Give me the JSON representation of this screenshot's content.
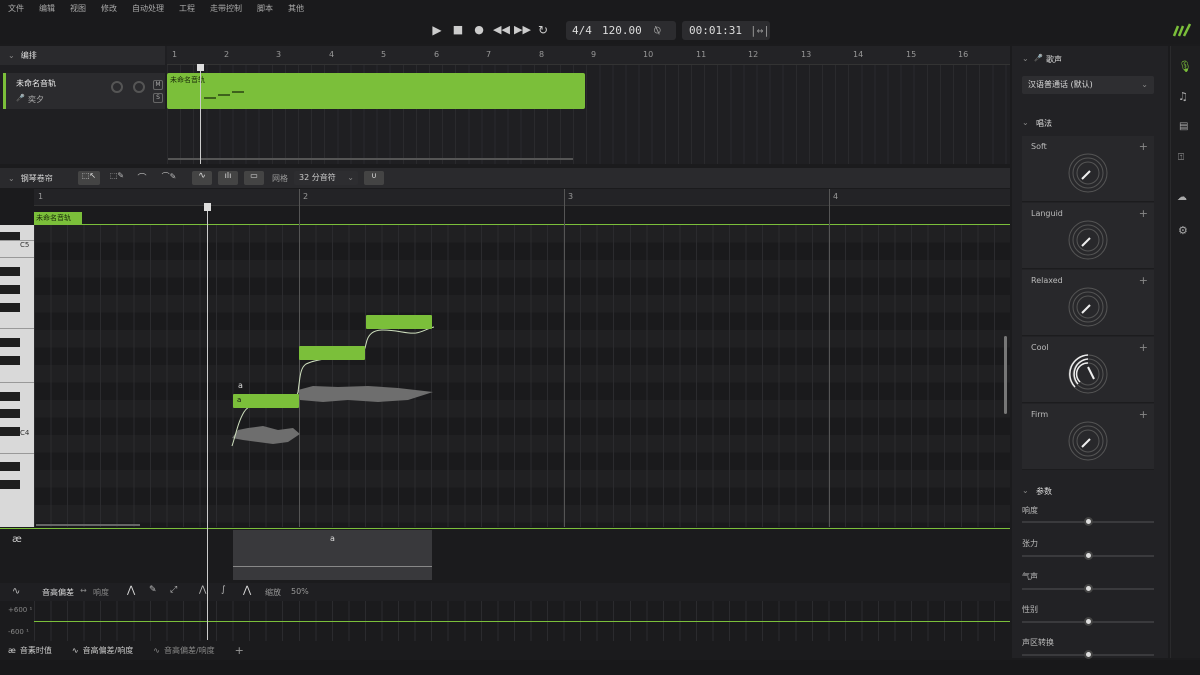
{
  "menu": [
    "文件",
    "编辑",
    "视图",
    "修改",
    "自动处理",
    "工程",
    "走带控制",
    "脚本",
    "其他"
  ],
  "transport": {
    "signature": "4/4",
    "tempo": "120.00",
    "time": "00:01:31"
  },
  "arrangement": {
    "title": "编排",
    "ruler": [
      "1",
      "2",
      "3",
      "4",
      "5",
      "6",
      "7",
      "8",
      "9",
      "10",
      "11",
      "12",
      "13",
      "14",
      "15",
      "16"
    ],
    "track": {
      "name": "未命名音轨",
      "singer": "奕夕",
      "mute": "M",
      "solo": "S"
    },
    "clip": {
      "name": "未命名音轨"
    }
  },
  "pianoroll": {
    "title": "钢琴卷帘",
    "grid_label": "网格",
    "grid_value": "32 分音符",
    "ruler": [
      "1",
      "2",
      "3",
      "4"
    ],
    "clip_tag": "未命名音轨",
    "key_c5": "C5",
    "key_c4": "C4",
    "notes": [
      {
        "lyric": "a"
      },
      {
        "lyric": ""
      },
      {
        "lyric": ""
      }
    ],
    "lyric_above": "a",
    "phoneme_label": "a"
  },
  "param_bar": {
    "primary": "音高偏差",
    "secondary": "响度",
    "scale_label": "缩放",
    "scale_value": "50%",
    "y_top": "+600 ¹",
    "y_bottom": "-600 ¹"
  },
  "bottom_tabs": [
    "音素时值",
    "音高偏差/响度",
    "音高偏差/响度",
    "+"
  ],
  "right_panel": {
    "voice_title": "歌声",
    "voice_select": "汉语普通话 (默认)",
    "style_title": "唱法",
    "expressions": [
      "Soft",
      "Languid",
      "Relaxed",
      "Cool",
      "Firm"
    ],
    "params_title": "参数",
    "params": [
      {
        "label": "响度",
        "value": 0.5
      },
      {
        "label": "张力",
        "value": 0.5
      },
      {
        "label": "气声",
        "value": 0.5
      },
      {
        "label": "性别",
        "value": 0.5
      },
      {
        "label": "声区转换",
        "value": 0.5
      }
    ]
  },
  "colors": {
    "accent": "#7bbf3a"
  }
}
